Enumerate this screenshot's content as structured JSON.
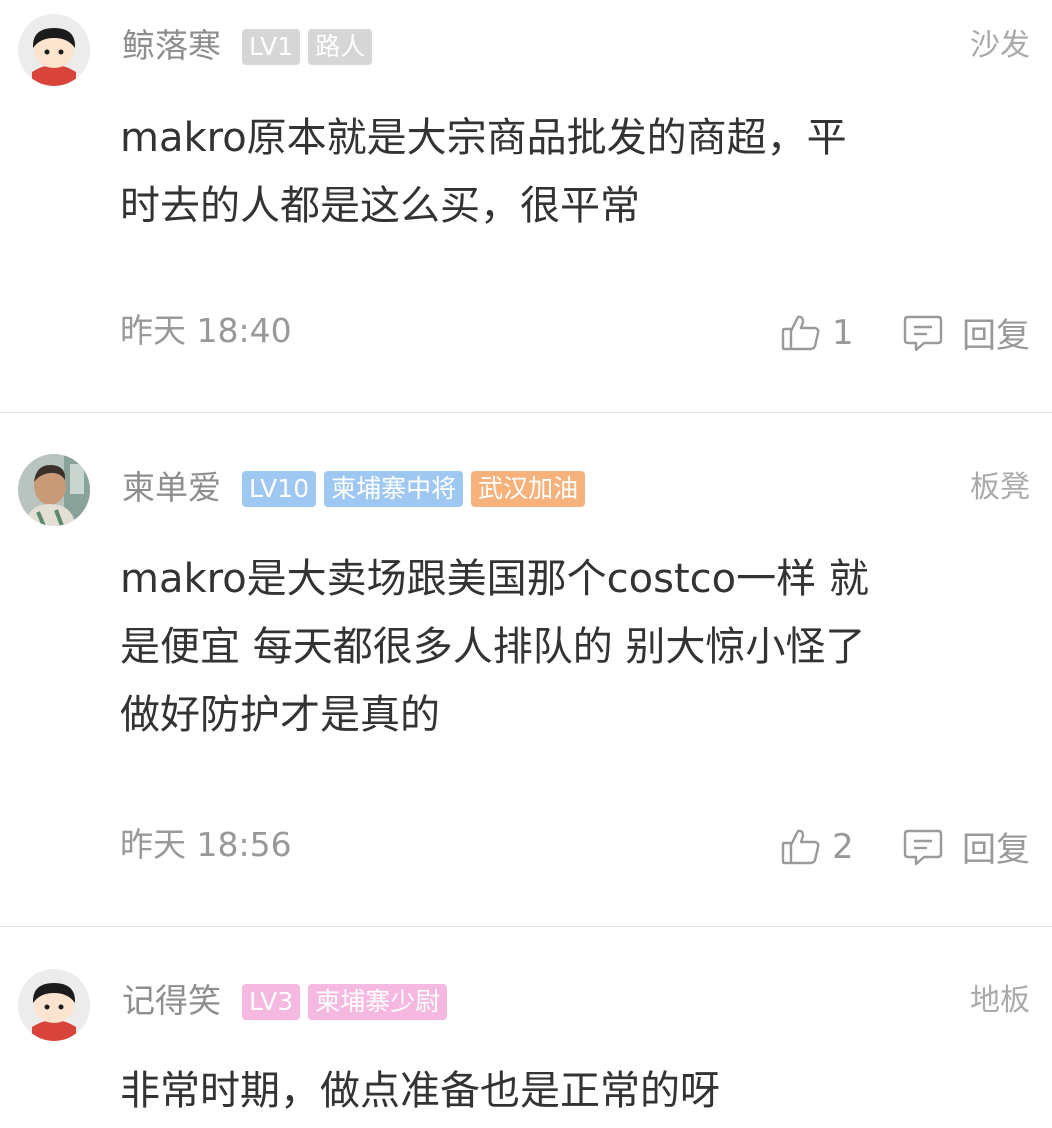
{
  "comments": [
    {
      "username": "鲸落寒",
      "badges": [
        {
          "text": "LV1",
          "color": "#d6d6d6"
        },
        {
          "text": "路人",
          "color": "#d6d6d6"
        }
      ],
      "floor": "沙发",
      "lines": [
        "makro原本就是大宗商品批发的商超，平",
        "时去的人都是这么买，很平常"
      ],
      "time": "昨天 18:40",
      "likes": "1",
      "reply_label": "回复"
    },
    {
      "username": "柬单爱",
      "badges": [
        {
          "text": "LV10",
          "color": "#9ec8f2"
        },
        {
          "text": "柬埔寨中将",
          "color": "#9ec8f2"
        },
        {
          "text": "武汉加油",
          "color": "#f6b27a"
        }
      ],
      "floor": "板凳",
      "lines": [
        "makro是大卖场跟美国那个costco一样 就",
        "是便宜 每天都很多人排队的 别大惊小怪了",
        "做好防护才是真的"
      ],
      "time": "昨天 18:56",
      "likes": "2",
      "reply_label": "回复"
    },
    {
      "username": "记得笑",
      "badges": [
        {
          "text": "LV3",
          "color": "#f5b8e0"
        },
        {
          "text": "柬埔寨少尉",
          "color": "#f5b8e0"
        }
      ],
      "floor": "地板",
      "lines": [
        "非常时期，做点准备也是正常的呀"
      ]
    }
  ],
  "icons": {
    "like": "thumbs-up-icon",
    "reply": "comment-icon"
  }
}
